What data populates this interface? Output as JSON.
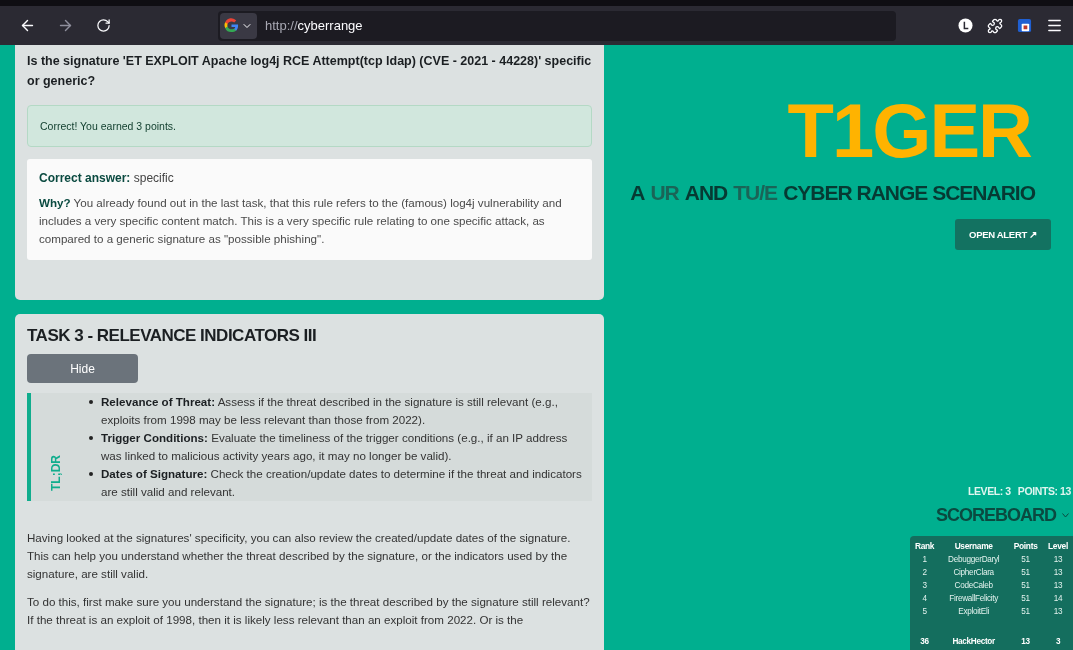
{
  "browser": {
    "nav_buttons": [
      {
        "kind": "back",
        "disabled": false
      },
      {
        "kind": "forward",
        "disabled": true
      },
      {
        "kind": "reload",
        "disabled": false
      }
    ],
    "url_scheme": "http://",
    "url_host": "cyberrange",
    "extensions": [
      {
        "kind": "account"
      },
      {
        "kind": "puzzle"
      },
      {
        "kind": "shield"
      },
      {
        "kind": "menu"
      }
    ]
  },
  "question_card": {
    "question": "Is the signature 'ET EXPLOIT Apache log4j RCE Attempt(tcp ldap) (CVE - 2021 - 44228)' specific or generic?",
    "alert": "Correct! You earned 3 points.",
    "answer": "**Correct answer:** specific",
    "why": "**Why?** You already found out in the last task, that this rule refers to the (famous) log4j vulnerability and includes a very specific content match. This is a very specific rule relating to one specific attack, as compared to a generic signature as \"possible phishing\"."
  },
  "task_card": {
    "title": "TASK 3 - RELEVANCE INDICATORS III",
    "hide_button": "Hide",
    "tldr_label": "TL;DR",
    "bullets": [
      "**Relevance of Threat:** Assess if the threat described in the signature is still relevant (e.g., exploits from 1998 may be less relevant than those from 2022).",
      "**Trigger Conditions:** Evaluate the timeliness of the trigger conditions (e.g., if an IP address was linked to malicious activity years ago, it may no longer be valid).",
      "**Dates of Signature:** Check the creation/update dates to determine if the threat and indicators are still valid and relevant."
    ],
    "paragraphs": [
      "Having looked at the signatures' specificity, you can also review the created/update dates of the signature. This can help you understand whether the threat described by the signature, or the indicators used by the signature, are still valid.",
      "To do this, first make sure you understand the signature; is the threat described by the signature still relevant? If the threat is an exploit of 1998, then it is likely less relevant than an exploit from 2022. Or is the"
    ]
  },
  "hero": {
    "logo": "T1GER",
    "subtitle": [
      {
        "text": "A",
        "highlight": false
      },
      {
        "text": "UR",
        "highlight": true
      },
      {
        "text": "AND",
        "highlight": false
      },
      {
        "text": "TU/E",
        "highlight": true
      },
      {
        "text": "CYBER RANGE SCENARIO",
        "highlight": false
      }
    ],
    "open_alert_button": "OPEN ALERT ↗"
  },
  "stats": {
    "level": "LEVEL: 3",
    "points": "POINTS: 13"
  },
  "scoreboard": {
    "title": "SCOREBOARD",
    "expanded": true,
    "columns": [
      "Rank",
      "Username",
      "Points",
      "Level"
    ],
    "rows": [
      {
        "cells": [
          "1",
          "DebuggerDaryl",
          "51",
          "13"
        ],
        "current_user": false
      },
      {
        "cells": [
          "2",
          "CipherClara",
          "51",
          "13"
        ],
        "current_user": false
      },
      {
        "cells": [
          "3",
          "CodeCaleb",
          "51",
          "13"
        ],
        "current_user": false
      },
      {
        "cells": [
          "4",
          "FirewallFelicity",
          "51",
          "14"
        ],
        "current_user": false
      },
      {
        "cells": [
          "5",
          "ExploitEli",
          "51",
          "13"
        ],
        "current_user": false
      },
      {
        "cells": [
          "36",
          "HackHector",
          "13",
          "3"
        ],
        "current_user": true
      }
    ]
  }
}
